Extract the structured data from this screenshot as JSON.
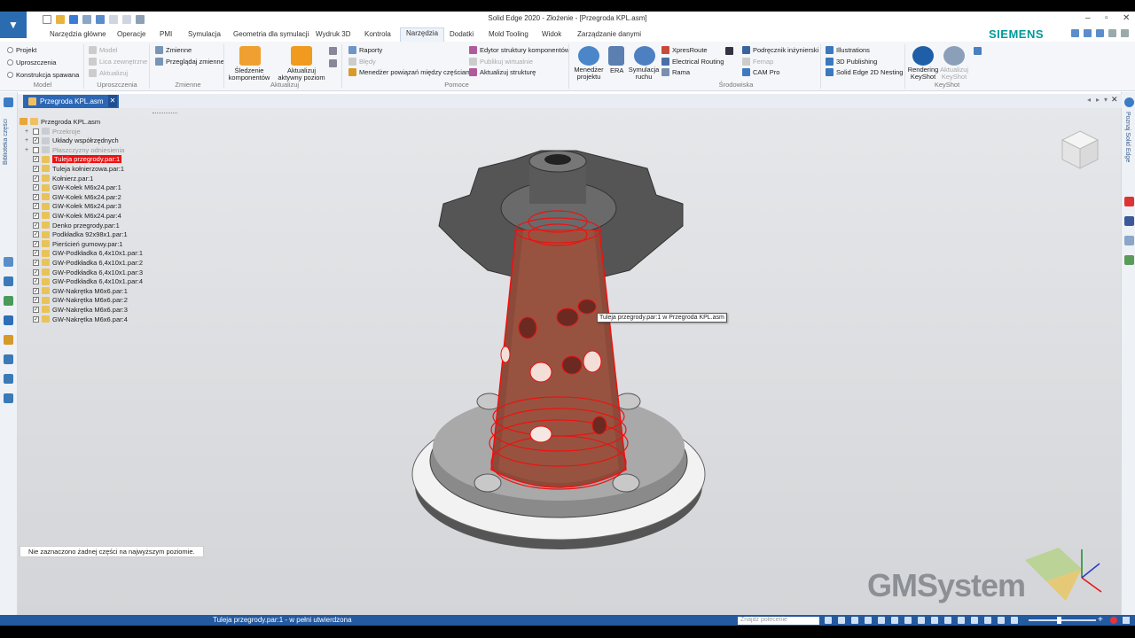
{
  "window": {
    "title": "Solid Edge 2020 - Złożenie - [Przegroda KPL.asm]",
    "controls": [
      "–",
      "▫",
      "✕"
    ]
  },
  "tabs": [
    "Narzędzia główne",
    "Operacje",
    "PMI",
    "Symulacja",
    "Geometria dla symulacji",
    "Wydruk 3D",
    "Kontrola",
    "Narzędzia",
    "Dodatki",
    "Mold Tooling",
    "Widok",
    "Zarządzanie danymi"
  ],
  "active_tab": "Narzędzia",
  "brand": "SIEMENS",
  "ribbon": {
    "model": {
      "projekt": "Projekt",
      "uproszczenia": "Uproszczenia",
      "konstrukcja": "Konstrukcja spawana",
      "group": "Model"
    },
    "uproszczenia": {
      "model": "Model",
      "lica": "Lica zewnętrzne",
      "aktualizuj": "Aktualizuj",
      "group": "Uproszczenia"
    },
    "zmienne": {
      "zmienne": "Zmienne",
      "przegladaj": "Przeglądaj zmienne",
      "group": "Zmienne"
    },
    "aktualizuj": {
      "sledzenie": "Śledzenie komponentów",
      "aktualizuj": "Aktualizuj aktywny poziom",
      "group": "Aktualizuj"
    },
    "pomoc": {
      "raporty": "Raporty",
      "bledy": "Błędy",
      "menedzer": "Menedżer powiązań między częściami",
      "edytor": "Edytor struktury komponentów",
      "publikuj": "Publikuj wirtualnie",
      "aktualizuj_strukture": "Aktualizuj strukturę",
      "group": "Pomoce"
    },
    "srodowiska": {
      "menedzer_projektu": "Menedżer projektu",
      "era": "ERA",
      "symulacja_ruchu": "Symulacja ruchu",
      "xpressroute": "XpresRoute",
      "electrical": "Electrical Routing",
      "rama": "Rama",
      "podrecznik": "Podręcznik inżynierski",
      "femap": "Femap",
      "cam": "CAM Pro",
      "group": "Środowiska"
    },
    "publishing": {
      "illustrations": "Illustrations",
      "publishing": "3D Publishing",
      "nesting": "Solid Edge 2D Nesting"
    },
    "keyshot": {
      "rendering": "Rendering KeyShot",
      "aktualizuj": "Aktualizuj KeyShot",
      "group": "KeyShot"
    }
  },
  "document_tab": "Przegroda KPL.asm",
  "left_panel_label": "Biblioteka części",
  "right_panel_label": "Poznaj Solid Edge",
  "tree": {
    "root": "Przegroda KPL.asm",
    "items": [
      {
        "label": "Przekroje",
        "checked": false,
        "type": "folder",
        "grey": true
      },
      {
        "label": "Układy współrzędnych",
        "checked": true,
        "type": "folder",
        "grey": false
      },
      {
        "label": "Płaszczyzny odniesienia",
        "checked": false,
        "type": "folder",
        "grey": true
      },
      {
        "label": "Tuleja przegrody.par:1",
        "checked": true,
        "type": "part",
        "selected": true
      },
      {
        "label": "Tuleja kołnierzowa.par:1",
        "checked": true,
        "type": "part"
      },
      {
        "label": "Kołnierz.par:1",
        "checked": true,
        "type": "part"
      },
      {
        "label": "GW-Kołek M6x24.par:1",
        "checked": true,
        "type": "part"
      },
      {
        "label": "GW-Kołek M6x24.par:2",
        "checked": true,
        "type": "part"
      },
      {
        "label": "GW-Kołek M6x24.par:3",
        "checked": true,
        "type": "part"
      },
      {
        "label": "GW-Kołek M6x24.par:4",
        "checked": true,
        "type": "part"
      },
      {
        "label": "Denko przegrody.par:1",
        "checked": true,
        "type": "part"
      },
      {
        "label": "Podkładka 92x98x1.par:1",
        "checked": true,
        "type": "part"
      },
      {
        "label": "Pierścień gumowy.par:1",
        "checked": true,
        "type": "part"
      },
      {
        "label": "GW-Podkładka 6,4x10x1.par:1",
        "checked": true,
        "type": "part"
      },
      {
        "label": "GW-Podkładka 6,4x10x1.par:2",
        "checked": true,
        "type": "part"
      },
      {
        "label": "GW-Podkładka 6,4x10x1.par:3",
        "checked": true,
        "type": "part"
      },
      {
        "label": "GW-Podkładka 6,4x10x1.par:4",
        "checked": true,
        "type": "part"
      },
      {
        "label": "GW-Nakrętka M6x6.par:1",
        "checked": true,
        "type": "part"
      },
      {
        "label": "GW-Nakrętka M6x6.par:2",
        "checked": true,
        "type": "part"
      },
      {
        "label": "GW-Nakrętka M6x6.par:3",
        "checked": true,
        "type": "part"
      },
      {
        "label": "GW-Nakrętka M6x6.par:4",
        "checked": true,
        "type": "part"
      }
    ]
  },
  "hint": "Nie zaznaczono żadnej części na najwyższym poziomie.",
  "tooltip": "Tuleja przegrody.par:1 w Przegroda KPL.asm",
  "status_text": "Tuleja przegrody.par:1 - w pełni utwierdzona",
  "command_search_placeholder": "Znajdź polecenie",
  "watermark": "GMSystem",
  "colors": {
    "accent": "#2c67b5",
    "selection": "#e11111",
    "siemens": "#009999"
  }
}
